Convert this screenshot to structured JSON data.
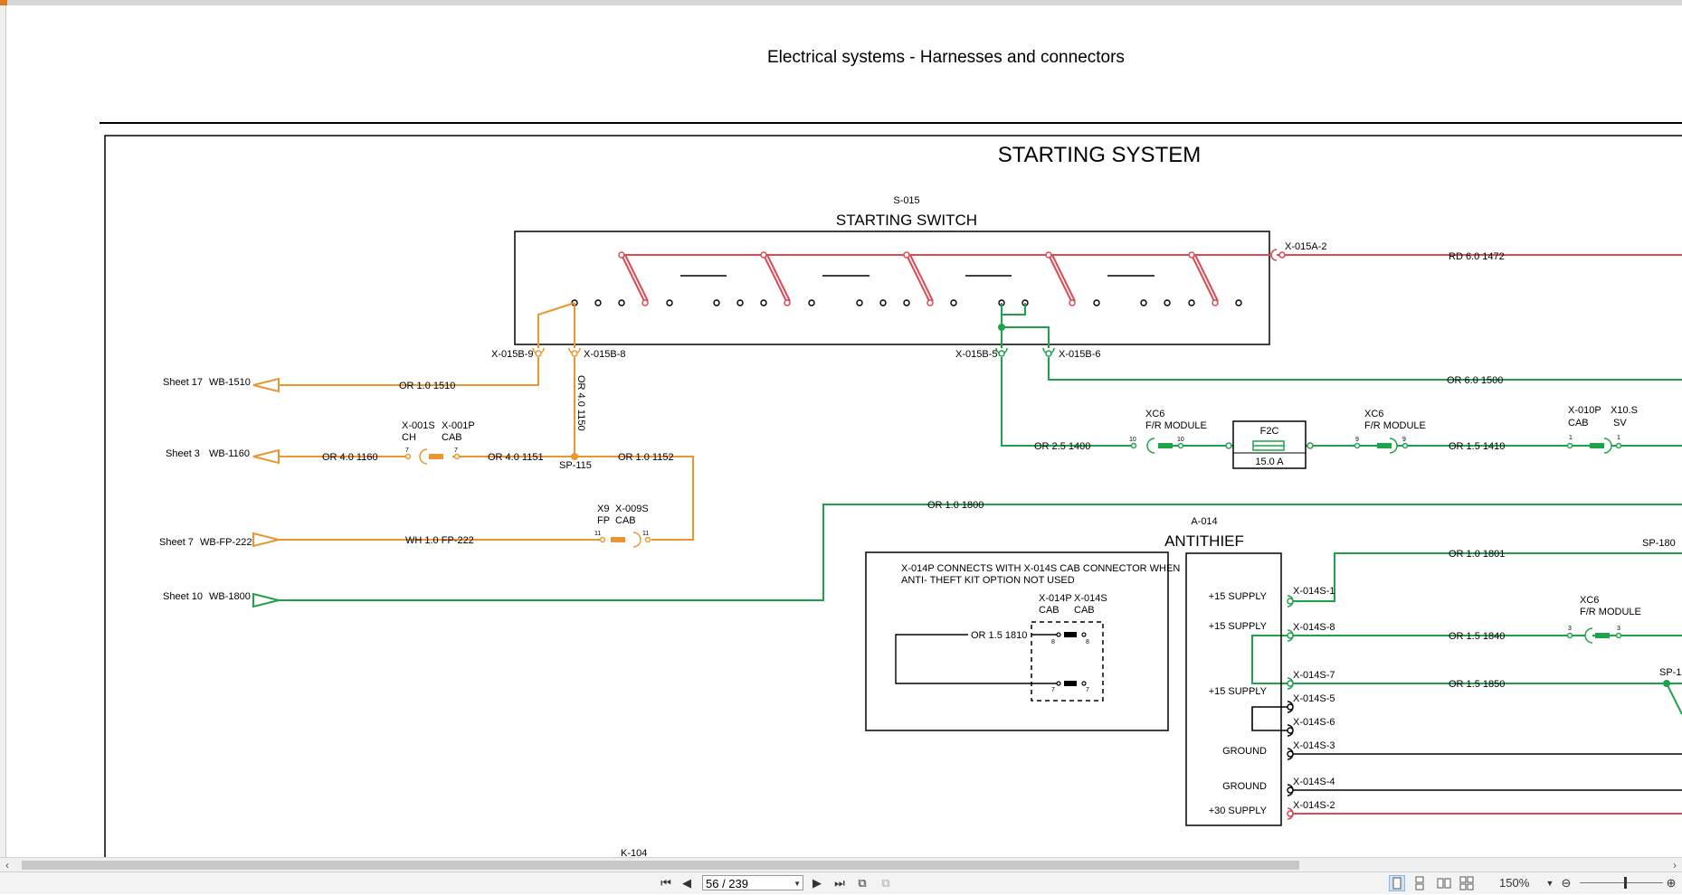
{
  "doc": {
    "header_title": "Electrical systems - Harnesses and connectors",
    "diagram_title": "STARTING SYSTEM",
    "switch": {
      "ref": "S-015",
      "name": "STARTING SWITCH"
    },
    "antithief": {
      "ref": "A-014",
      "name": "ANTITHIEF"
    },
    "note": {
      "text_line1": "X-014P CONNECTS WITH X-014S CAB CONNECTOR WHEN",
      "text_line2": "ANTI- THEFT KIT OPTION NOT USED",
      "conn_p": "X-014P",
      "conn_p_loc": "CAB",
      "conn_s": "X-014S",
      "conn_s_loc": "CAB",
      "wire": "OR 1.5 1810",
      "pin_top_l": "8",
      "pin_top_r": "8",
      "pin_bot_l": "7",
      "pin_bot_r": "7"
    },
    "sheets": {
      "s17": "Sheet 17",
      "s17_wb": "WB-1510",
      "s3": "Sheet 3",
      "s3_wb": "WB-1160",
      "s7": "Sheet 7",
      "s7_wb": "WB-FP-222",
      "s10": "Sheet 10",
      "s10_wb": "WB-1800"
    },
    "wires": {
      "w1510": "OR 1.0 1510",
      "w1150": "OR 4.0 1150",
      "w1160": "OR 4.0 1160",
      "w1151": "OR 4.0 1151",
      "w1152": "OR 1.0 1152",
      "wfp222": "WH 1.0 FP-222",
      "w1800": "OR 1.0 1800",
      "w1472": "RD 6.0 1472",
      "w1500": "OR 6.0 1500",
      "w1400": "OR 2.5 1400",
      "w1410": "OR 1.5 1410",
      "w1801": "OR 1.0 1801",
      "w1840": "OR 1.5 1840",
      "w1850": "OR 1.5 1850"
    },
    "connectors": {
      "x015a2": "X-015A-2",
      "x015b9": "X-015B-9",
      "x015b8": "X-015B-8",
      "x015b5": "X-015B-5",
      "x015b6": "X-015B-6",
      "sp115": "SP-115",
      "sp180": "SP-180",
      "sp18x": "SP-1",
      "x001s": "X-001S",
      "x001s_loc": "CH",
      "x001p": "X-001P",
      "x001p_loc": "CAB",
      "x001_pin": "7",
      "x9": "X9",
      "x9_loc": "FP",
      "x009s": "X-009S",
      "x009s_loc": "CAB",
      "x9_pin": "11",
      "xc6": "XC6",
      "fr_module": "F/R MODULE",
      "xc6_pin_a": "10",
      "xc6_pin_b": "9",
      "xc6_pin_c": "3",
      "f2c": "F2C",
      "f2c_rating": "15.0 A",
      "x010p": "X-010P",
      "x010p_loc": "CAB",
      "x10s": "X10.S",
      "x10s_loc": "SV",
      "x010_pin": "1",
      "k104": "K-104"
    },
    "antithief_pins": [
      {
        "label": "+15 SUPPLY",
        "pin": "X-014S-1"
      },
      {
        "label": "+15 SUPPLY",
        "pin": "X-014S-8"
      },
      {
        "label": "+15 SUPPLY",
        "pin": "X-014S-7"
      },
      {
        "label": "",
        "pin": "X-014S-5"
      },
      {
        "label": "",
        "pin": "X-014S-6"
      },
      {
        "label": "GROUND",
        "pin": "X-014S-3"
      },
      {
        "label": "GROUND",
        "pin": "X-014S-4"
      },
      {
        "label": "+30 SUPPLY",
        "pin": "X-014S-2"
      }
    ]
  },
  "viewer": {
    "page_value": "56 / 239",
    "zoom": "150%",
    "colors": {
      "orange": "#e8962e",
      "green": "#1fa34a",
      "red": "#dc4a55",
      "black": "#000000"
    }
  }
}
